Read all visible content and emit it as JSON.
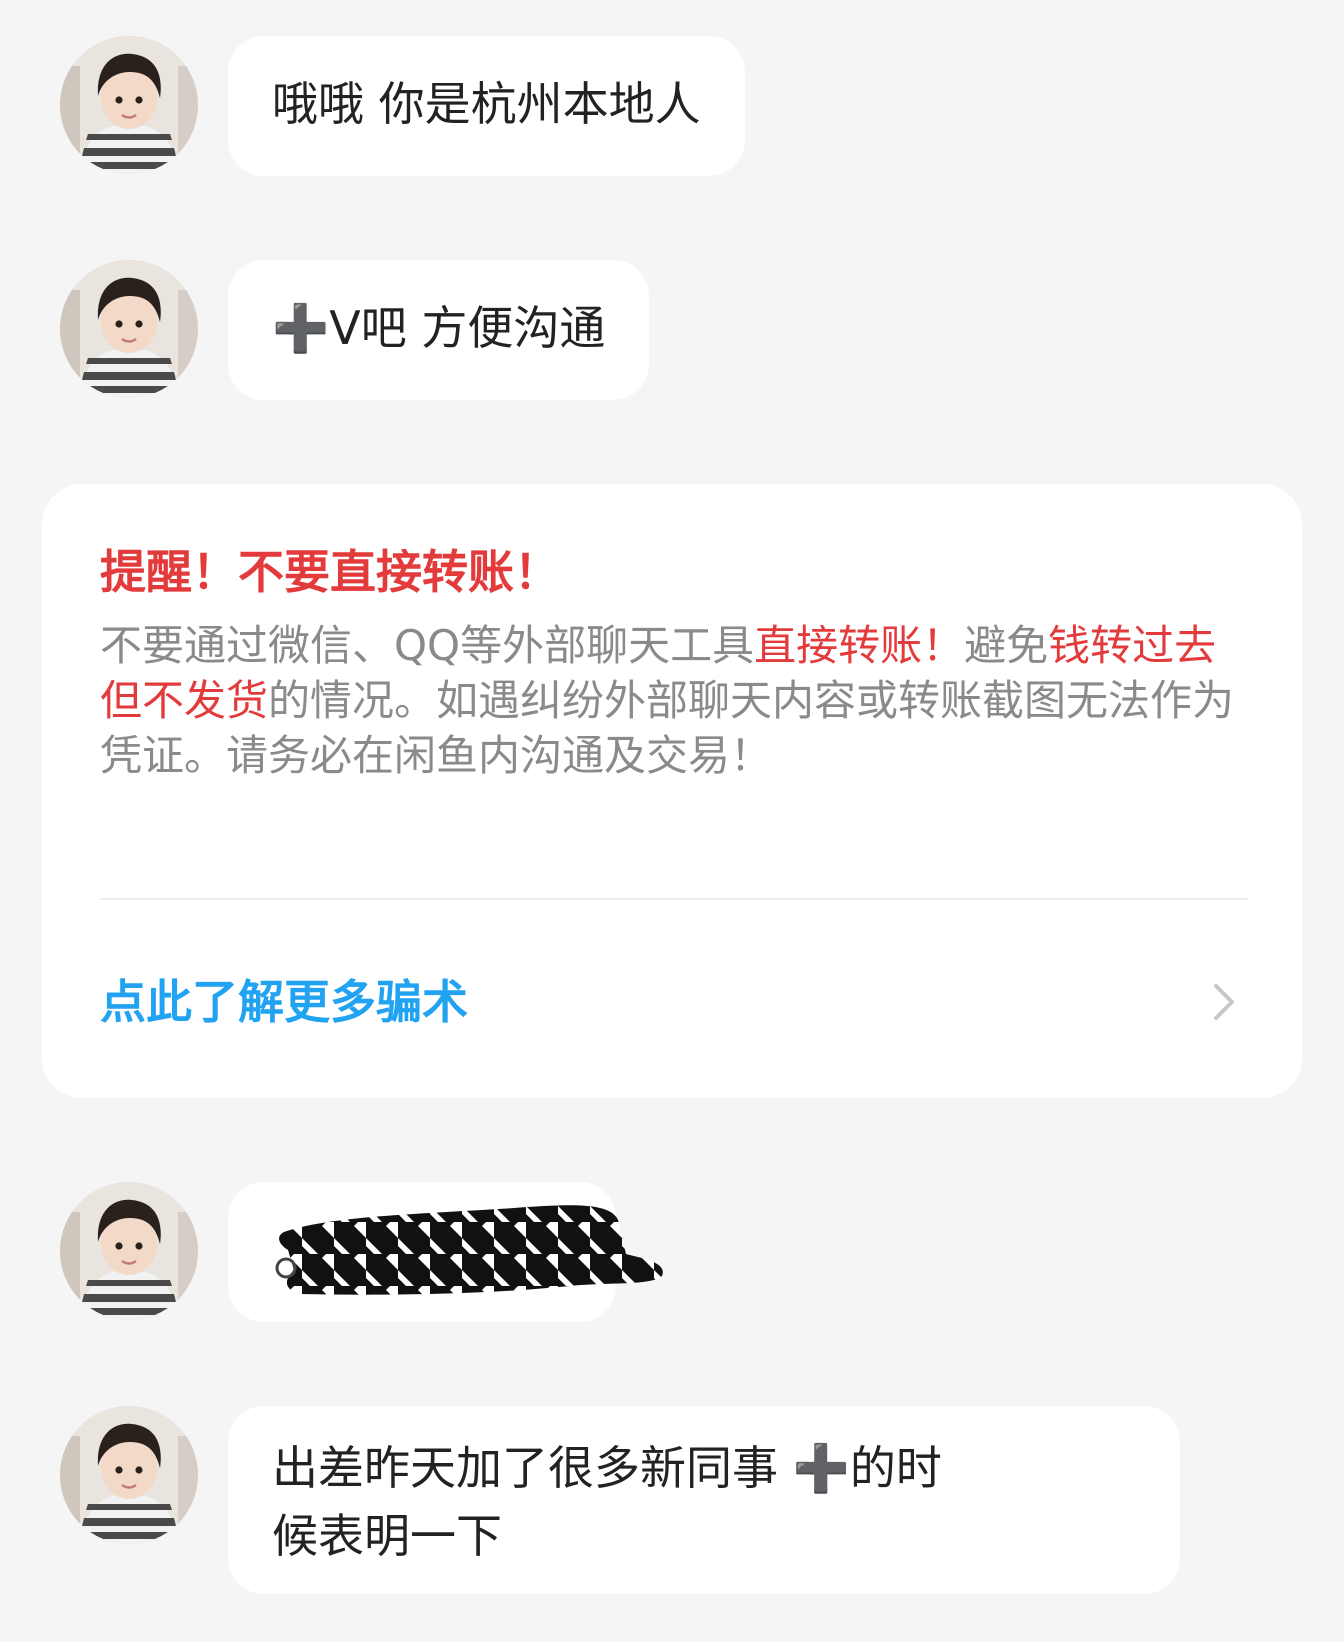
{
  "messages": [
    {
      "text": "哦哦 你是杭州本地人"
    },
    {
      "text": "➕V吧 方便沟通"
    },
    {
      "text": ""
    },
    {
      "line1": "出差昨天加了很多新同事 ➕的时",
      "line2": "候表明一下"
    }
  ],
  "warning": {
    "title": "提醒！不要直接转账！",
    "body": [
      {
        "text": "不要通过微信、QQ等外部聊天工具",
        "highlight": false
      },
      {
        "text": "直接转账！",
        "highlight": true
      },
      {
        "text": "避免",
        "highlight": false
      },
      {
        "text": "钱转过去但不发货",
        "highlight": true
      },
      {
        "text": "的情况。如遇纠纷外部聊天内容或转账截图无法作为凭证。请务必在闲鱼内沟通及交易！",
        "highlight": false
      }
    ],
    "link": "点此了解更多骗术"
  },
  "colors": {
    "background": "#f5f5f5",
    "bubble": "#ffffff",
    "warning_red": "#e33b3b",
    "link_blue": "#21a3f1",
    "body_gray": "#8a8a8a"
  },
  "icons": {
    "avatar": "child-avatar-icon",
    "chevron": "chevron-right-icon"
  }
}
